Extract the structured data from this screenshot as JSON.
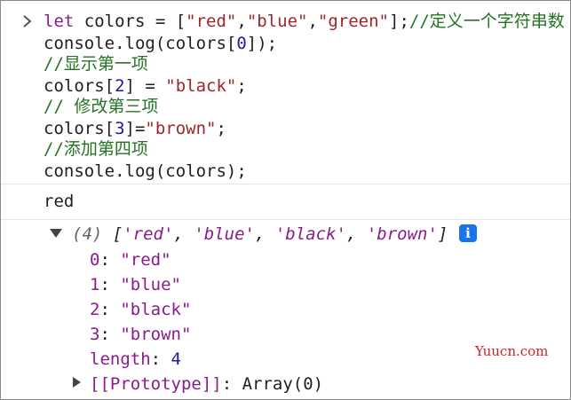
{
  "code": {
    "line1": {
      "kw": "let",
      "pre": " colors = [",
      "s1": "\"red\"",
      "c1": ",",
      "s2": "\"blue\"",
      "c2": ",",
      "s3": "\"green\"",
      "post": "];",
      "comment": "//定义一个字符串数"
    },
    "line2": {
      "pre": "console.log(colors[",
      "num": "0",
      "post": "]);"
    },
    "line3": {
      "comment": "//显示第一项"
    },
    "line4": {
      "pre": "colors[",
      "num": "2",
      "mid": "] = ",
      "str": "\"black\"",
      "post": ";"
    },
    "line5": {
      "comment": "// 修改第三项"
    },
    "line6": {
      "pre": "colors[",
      "num": "3",
      "mid": "]=",
      "str": "\"brown\"",
      "post": ";"
    },
    "line7": {
      "comment": "//添加第四项"
    },
    "line8": {
      "text": "console.log(colors);"
    }
  },
  "output": {
    "log1": "red",
    "array_summary": {
      "count": "(4)",
      "open": "[",
      "items": [
        "'red'",
        "'blue'",
        "'black'",
        "'brown'"
      ],
      "close": "]"
    },
    "entries": [
      {
        "key": "0",
        "value": "\"red\""
      },
      {
        "key": "1",
        "value": "\"blue\""
      },
      {
        "key": "2",
        "value": "\"black\""
      },
      {
        "key": "3",
        "value": "\"brown\""
      }
    ],
    "length_key": "length",
    "length_value": "4",
    "prototype_key": "[[Prototype]]",
    "prototype_value": "Array(0)"
  },
  "info_icon": "i",
  "watermark": "Yuucn.com",
  "icons": {
    "prompt": "chevron-right-icon",
    "expanded": "triangle-down-icon",
    "collapsed": "triangle-right-icon",
    "info": "info-icon"
  }
}
